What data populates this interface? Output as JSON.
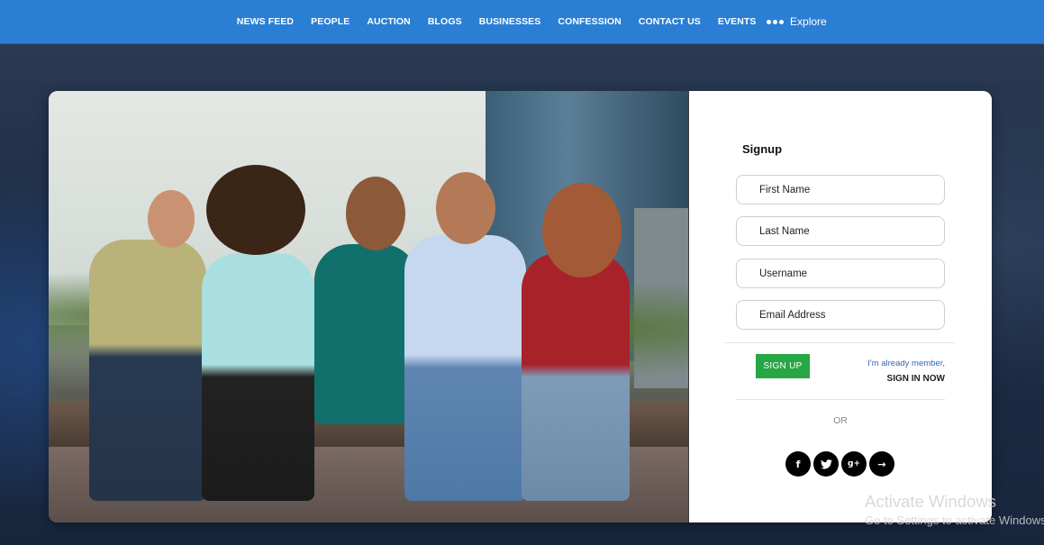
{
  "nav": {
    "items": [
      "NEWS FEED",
      "PEOPLE",
      "AUCTION",
      "BLOGS",
      "BUSINESSES",
      "CONFESSION",
      "CONTACT US",
      "EVENTS"
    ],
    "explore_label": "Explore"
  },
  "form": {
    "title": "Signup",
    "fields": {
      "first_name": "First Name",
      "last_name": "Last Name",
      "username": "Username",
      "email": "Email Address"
    },
    "signup_button": "SIGN UP",
    "already_member": "I'm already member,",
    "sign_in": "SIGN IN NOW",
    "or": "OR",
    "social": {
      "facebook": "f",
      "twitter": "t",
      "google_plus": "g+",
      "arrow": "→"
    }
  },
  "watermark": {
    "line1": "Activate Windows",
    "line2": "Go to Settings to activate Windows."
  },
  "colors": {
    "nav_bg": "#2a7fd4",
    "signup_green": "#27a644",
    "link_blue": "#3366bb"
  }
}
